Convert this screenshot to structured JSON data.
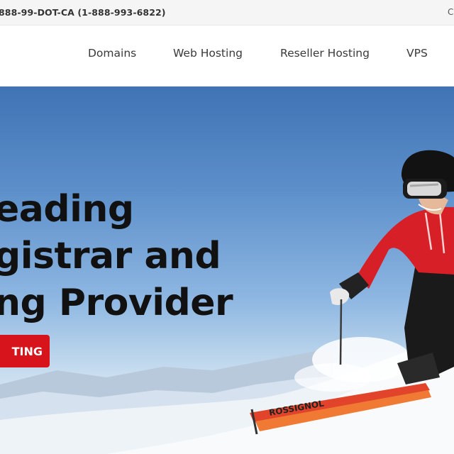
{
  "topbar": {
    "phone_text": "888-99-DOT-CA (1-888-993-6822)",
    "right_cut_text": "C"
  },
  "nav": {
    "items": [
      {
        "label": "Domains"
      },
      {
        "label": "Web Hosting"
      },
      {
        "label": "Reseller Hosting"
      },
      {
        "label": "VPS"
      }
    ]
  },
  "hero": {
    "headline_lines": [
      "eading",
      "gistrar and",
      "ng Provider"
    ],
    "cta_label": "TING",
    "ski_brand": "ROSSIGNOL"
  },
  "colors": {
    "accent": "#d7141b",
    "sky_top": "#3f73b4",
    "jacket": "#d61f26"
  }
}
